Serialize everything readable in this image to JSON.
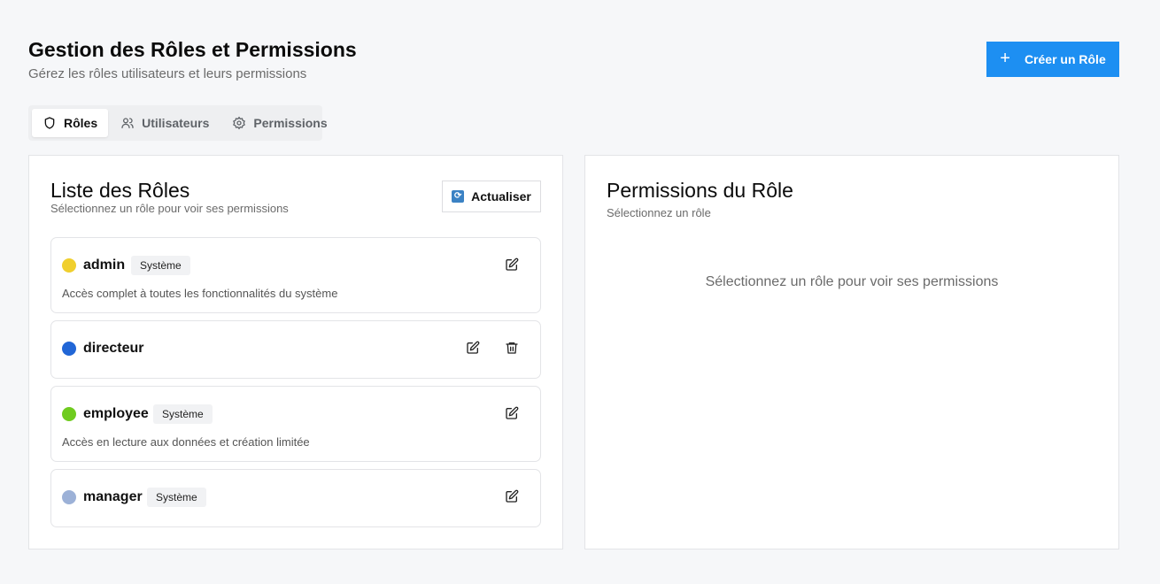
{
  "header": {
    "title": "Gestion des Rôles et Permissions",
    "subtitle": "Gérez les rôles utilisateurs et leurs permissions",
    "create_button": "Créer un Rôle"
  },
  "tabs": [
    {
      "label": "Rôles",
      "icon": "shield-icon",
      "active": true
    },
    {
      "label": "Utilisateurs",
      "icon": "users-icon",
      "active": false
    },
    {
      "label": "Permissions",
      "icon": "gear-icon",
      "active": false
    }
  ],
  "roles_panel": {
    "title": "Liste des Rôles",
    "subtitle": "Sélectionnez un rôle pour voir ses permissions",
    "refresh_button": "Actualiser",
    "roles": [
      {
        "name": "admin",
        "color": "#f0cf2e",
        "badge": "Système",
        "description": "Accès complet à toutes les fonctionnalités du système",
        "deletable": false
      },
      {
        "name": "directeur",
        "color": "#2166d6",
        "badge": "",
        "description": "",
        "deletable": true
      },
      {
        "name": "employee",
        "color": "#6fcb1f",
        "badge": "Système",
        "description": "Accès en lecture aux données et création limitée",
        "deletable": false
      },
      {
        "name": "manager",
        "color": "#9cb1d7",
        "badge": "Système",
        "description": "",
        "deletable": false
      }
    ]
  },
  "permissions_panel": {
    "title": "Permissions du Rôle",
    "subtitle": "Sélectionnez un rôle",
    "empty_message": "Sélectionnez un rôle pour voir ses permissions"
  }
}
